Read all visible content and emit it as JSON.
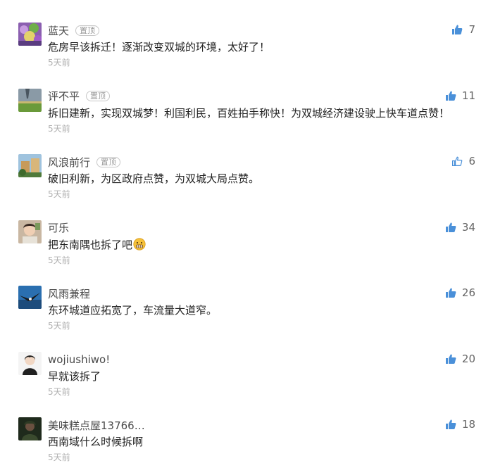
{
  "comments": [
    {
      "name": "蓝天",
      "badge": "置顶",
      "text": "危房早该拆迁！逐渐改变双城的环境，太好了！",
      "time": "5天前",
      "likes": "7",
      "avatar": "purple-crowd-avatar"
    },
    {
      "name": "评不平",
      "badge": "置顶",
      "text": "拆旧建新，实现双城梦！利国利民，百姓拍手称快！为双城经济建设驶上快车道点赞！",
      "time": "5天前",
      "likes": "11",
      "avatar": "storm-landscape-avatar"
    },
    {
      "name": "风浪前行",
      "badge": "置顶",
      "text": "破旧利新，为区政府点赞，为双城大局点赞。",
      "time": "5天前",
      "likes": "6",
      "avatar": "building-avatar"
    },
    {
      "name": "可乐",
      "badge": "",
      "text": "把东南隅也拆了吧",
      "time": "5天前",
      "likes": "34",
      "avatar": "child-avatar",
      "emoji": "grimace-emoji"
    },
    {
      "name": "风雨兼程",
      "badge": "",
      "text": "东环城道应拓宽了，车流量大道窄。",
      "time": "5天前",
      "likes": "26",
      "avatar": "eagle-avatar"
    },
    {
      "name": "wojiushiwo!",
      "badge": "",
      "text": "早就该拆了",
      "time": "5天前",
      "likes": "20",
      "avatar": "portrait-avatar"
    },
    {
      "name": "美味糕点屋13766…",
      "badge": "",
      "text": "西南域什么时候拆啊",
      "time": "5天前",
      "likes": "18",
      "avatar": "dark-figure-avatar"
    }
  ],
  "colors": {
    "like_icon_filled": "#4a90d9",
    "like_icon_outline": "#4a90d9"
  }
}
